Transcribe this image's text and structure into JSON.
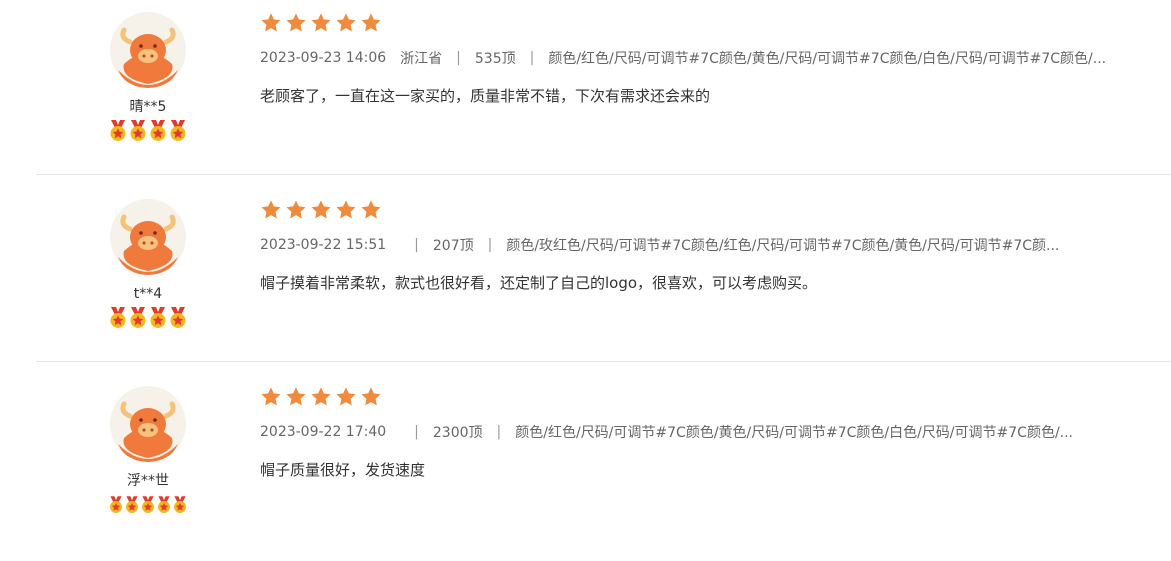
{
  "colors": {
    "star": "#f08a3c",
    "divider": "#e6e6e6",
    "avatar_face": "#f07a3c"
  },
  "reviews": [
    {
      "username": "晴**5",
      "badge_count": 4,
      "rating": 5,
      "date": "2023-09-23 14:06",
      "location": "浙江省",
      "size_label": "535顶",
      "spec": "颜色/红色/尺码/可调节#7C颜色/黄色/尺码/可调节#7C颜色/白色/尺码/可调节#7C颜色/...",
      "text": "老顾客了，一直在这一家买的，质量非常不错，下次有需求还会来的"
    },
    {
      "username": "t**4",
      "badge_count": 4,
      "rating": 5,
      "date": "2023-09-22 15:51",
      "location": "",
      "size_label": "207顶",
      "spec": "颜色/玫红色/尺码/可调节#7C颜色/红色/尺码/可调节#7C颜色/黄色/尺码/可调节#7C颜...",
      "text": "帽子摸着非常柔软，款式也很好看，还定制了自己的logo，很喜欢，可以考虑购买。"
    },
    {
      "username": "浮**世",
      "badge_count": 5,
      "rating": 5,
      "date": "2023-09-22 17:40",
      "location": "",
      "size_label": "2300顶",
      "spec": "颜色/红色/尺码/可调节#7C颜色/黄色/尺码/可调节#7C颜色/白色/尺码/可调节#7C颜色/...",
      "text": "帽子质量很好，发货速度"
    }
  ]
}
